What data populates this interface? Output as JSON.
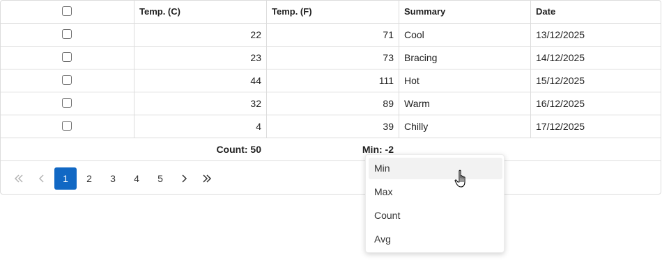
{
  "grid": {
    "headers": [
      "",
      "Temp. (C)",
      "Temp. (F)",
      "Summary",
      "Date"
    ],
    "rows": [
      {
        "temp_c": "22",
        "temp_f": "71",
        "summary": "Cool",
        "date": "13/12/2025"
      },
      {
        "temp_c": "23",
        "temp_f": "73",
        "summary": "Bracing",
        "date": "14/12/2025"
      },
      {
        "temp_c": "44",
        "temp_f": "111",
        "summary": "Hot",
        "date": "15/12/2025"
      },
      {
        "temp_c": "32",
        "temp_f": "89",
        "summary": "Warm",
        "date": "16/12/2025"
      },
      {
        "temp_c": "4",
        "temp_f": "39",
        "summary": "Chilly",
        "date": "17/12/2025"
      }
    ],
    "footer": {
      "temp_c_aggregate": "Count: 50",
      "temp_f_aggregate": "Min: -2"
    }
  },
  "pager": {
    "pages": [
      "1",
      "2",
      "3",
      "4",
      "5"
    ],
    "active_page": "1",
    "icons": {
      "first": "double-chevron-left-icon",
      "prev": "chevron-left-icon",
      "next": "chevron-right-icon",
      "last": "double-chevron-right-icon"
    }
  },
  "aggregate_menu": {
    "items": [
      "Min",
      "Max",
      "Count",
      "Avg"
    ],
    "hovered": "Min"
  },
  "colors": {
    "accent": "#1168c4",
    "border": "#dcdcdc",
    "menu_hover": "#f2f2f2"
  }
}
